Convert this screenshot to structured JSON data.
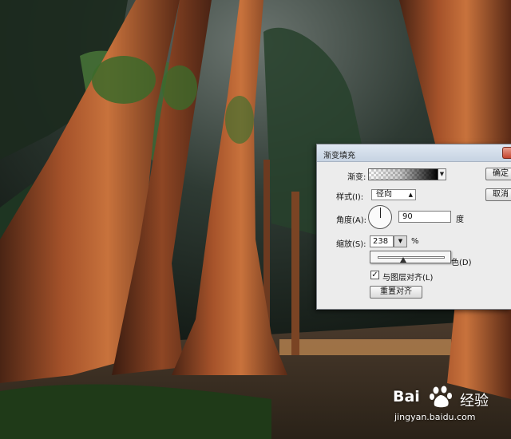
{
  "dialog": {
    "title": "渐变填充",
    "gradient_label": "渐变:",
    "style_label": "样式(I):",
    "style_value": "径向",
    "angle_label": "角度(A):",
    "angle_value": "90",
    "angle_unit": "度",
    "scale_label": "缩放(S):",
    "scale_value": "238",
    "scale_unit": "%",
    "reverse_label_partial": "色(D)",
    "align_label": "与图层对齐(L)",
    "align_checked": "✓",
    "reset_align_label": "重置对齐",
    "ok_label": "确定",
    "cancel_label": "取消",
    "slider_fraction": 0.38
  },
  "watermark": {
    "brand": "Bai",
    "brand_tail": "经验",
    "url": "jingyan.baidu.com"
  },
  "icons": {
    "dropdown": "chevron-down-icon",
    "close": "close-icon",
    "paw": "baidu-paw-icon"
  }
}
